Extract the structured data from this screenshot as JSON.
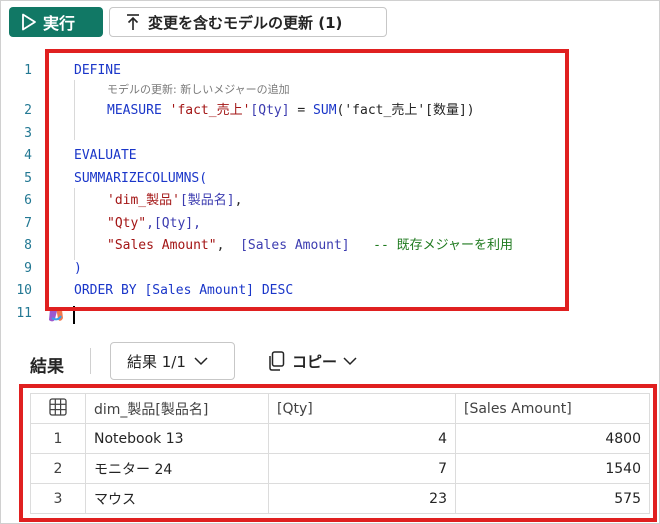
{
  "toolbar": {
    "run_label": "実行",
    "update_label": "変更を含むモデルの更新 (1)"
  },
  "editor": {
    "line_numbers": [
      "1",
      "2",
      "3",
      "4",
      "5",
      "6",
      "7",
      "8",
      "9",
      "10",
      "11"
    ],
    "hint": "モデルの更新: 新しいメジャーの追加",
    "lines": {
      "l1_define": "DEFINE",
      "l2_measure": "MEASURE",
      "l2_table": "'fact_売上'",
      "l2_col": "[Qty]",
      "l2_eq": " = ",
      "l2_fn": "SUM",
      "l2_arg": "('fact_売上'[数量])",
      "l4_evaluate": "EVALUATE",
      "l5_summarize": "SUMMARIZECOLUMNS(",
      "l6_table": "'dim_製品'",
      "l6_col": "[製品名]",
      "l6_comma": ",",
      "l7_str": "\"Qty\"",
      "l7_rest": ",[Qty],",
      "l8_str": "\"Sales Amount\"",
      "l8_comma": ",  ",
      "l8_col": "[Sales Amount]",
      "l8_comment": "   -- 既存メジャーを利用",
      "l9_paren": ")",
      "l10_order": "ORDER BY [Sales Amount] DESC"
    }
  },
  "results": {
    "title": "結果",
    "select_label": "結果 1/1",
    "copy_label": "コピー",
    "columns": [
      "dim_製品[製品名]",
      "[Qty]",
      "[Sales Amount]"
    ],
    "rows": [
      {
        "n": "1",
        "name": "Notebook 13",
        "qty": "4",
        "amount": "4800"
      },
      {
        "n": "2",
        "name": "モニター 24",
        "qty": "7",
        "amount": "1540"
      },
      {
        "n": "3",
        "name": "マウス",
        "qty": "23",
        "amount": "575"
      }
    ]
  },
  "colors": {
    "run_button": "#117865",
    "highlight_box": "#e02020",
    "keyword": "#1a36c9",
    "string": "#a31515",
    "comment": "#1f7a1f"
  },
  "icons": {
    "run": "play-icon",
    "update": "arrow-up-icon",
    "select": "chevron-down-icon",
    "copy": "copy-icon",
    "grid": "table-grid-icon",
    "copilot": "copilot-icon"
  }
}
